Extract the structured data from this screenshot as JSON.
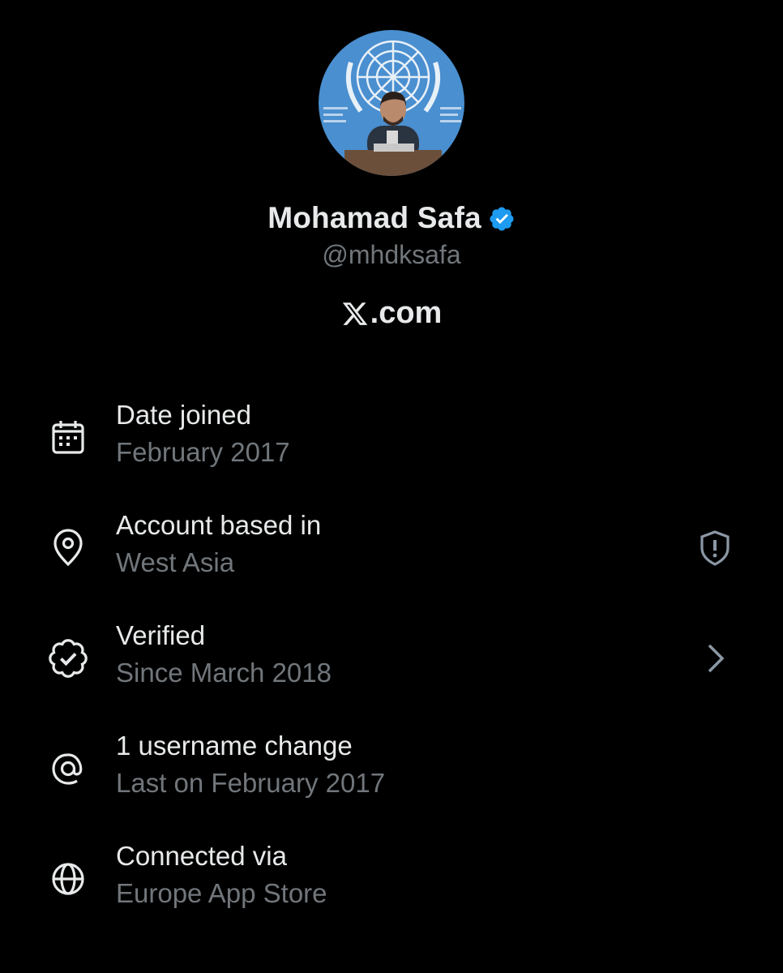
{
  "profile": {
    "display_name": "Mohamad Safa",
    "handle": "@mhdksafa",
    "verified": true
  },
  "brand": {
    "x_glyph": "𝕏",
    "domain": ".com"
  },
  "rows": [
    {
      "icon": "calendar-icon",
      "title": "Date joined",
      "subtitle": "February 2017"
    },
    {
      "icon": "location-pin-icon",
      "title": "Account based in",
      "subtitle": "West Asia",
      "action_icon": "shield-alert-icon"
    },
    {
      "icon": "verified-icon",
      "title": "Verified",
      "subtitle": "Since March 2018",
      "action_icon": "chevron-right-icon"
    },
    {
      "icon": "at-sign-icon",
      "title": "1 username change",
      "subtitle": "Last on February 2017"
    },
    {
      "icon": "globe-icon",
      "title": "Connected via",
      "subtitle": "Europe App Store"
    }
  ],
  "colors": {
    "background": "#000000",
    "primary_text": "#e7e9ea",
    "secondary_text": "#71767b",
    "verified_blue": "#1d9bf0",
    "un_blue": "#3f87c9"
  }
}
